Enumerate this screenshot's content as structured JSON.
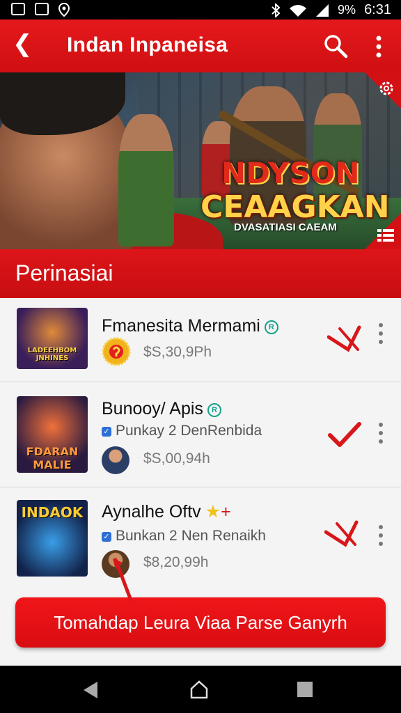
{
  "status_bar": {
    "battery": "9%",
    "time": "6:31"
  },
  "app_bar": {
    "title": "Indan Inpaneisa"
  },
  "banner": {
    "line1": "NDYSON",
    "line2": "CEAAGKAN",
    "line3": "DVASATIASI CAEAM"
  },
  "section": {
    "title": "Perinasiai"
  },
  "items": [
    {
      "name": "Fmanesita Mermami",
      "subtitle": "",
      "price": "$S,30,9Ph",
      "thumb_label": "LADEEHBOM JNHINES",
      "mark": "cross-check"
    },
    {
      "name": "Bunooy/ Apis",
      "subtitle": "Punkay 2 DenRenbida",
      "price": "$S,00,94h",
      "thumb_label": "FDARAN MALIE",
      "mark": "check"
    },
    {
      "name": "Aynalhe Oftv",
      "subtitle": "Bunkan 2 Nen Renaikh",
      "price": "$8,20,99h",
      "thumb_label": "INDAOK",
      "mark": "cross-check"
    }
  ],
  "cta": {
    "label": "Tomahdap Leura Viaa Parse Ganyrh"
  },
  "colors": {
    "brand_red": "#d80d11",
    "badge_teal": "#16a08a",
    "verify_blue": "#2e6fd6"
  }
}
